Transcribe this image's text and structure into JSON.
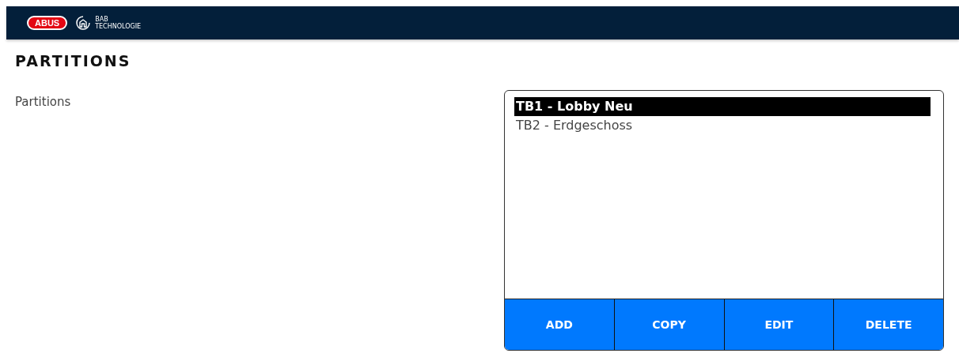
{
  "header": {
    "brand": "ABUS",
    "partner_line_1": "BAB",
    "partner_line_2": "TECHNOLOGIE"
  },
  "page_title": "PARTITIONS",
  "field_label": "Partitions",
  "partitions": [
    {
      "label": "TB1 - Lobby Neu",
      "selected": true
    },
    {
      "label": "TB2 - Erdgeschoss",
      "selected": false
    }
  ],
  "buttons": [
    "ADD",
    "COPY",
    "EDIT",
    "DELETE"
  ]
}
